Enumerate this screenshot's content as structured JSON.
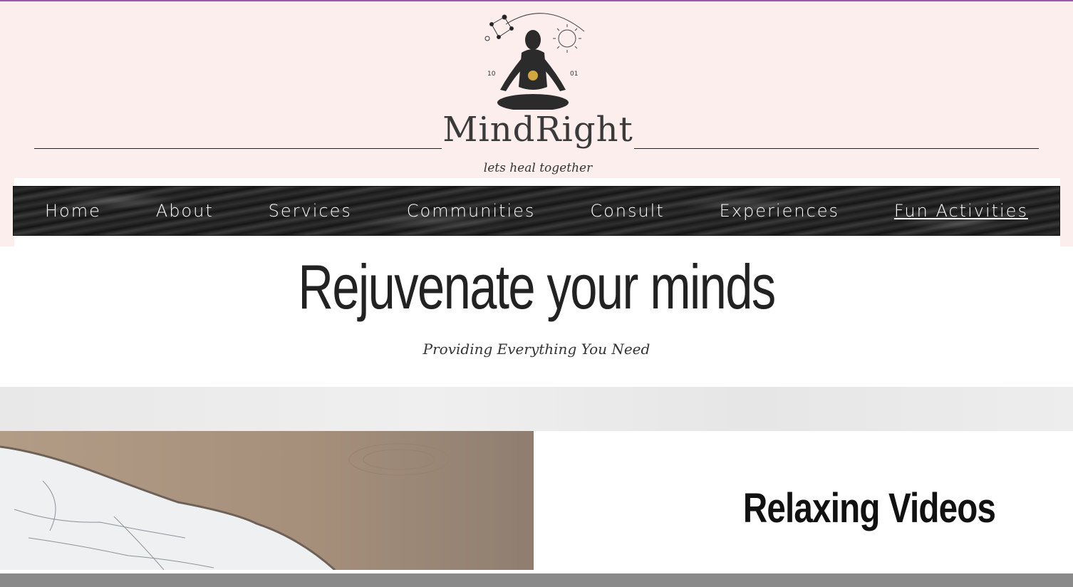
{
  "brand": {
    "name": "MindRight",
    "tagline": "lets heal together"
  },
  "nav": {
    "items": [
      {
        "label": "Home"
      },
      {
        "label": "About"
      },
      {
        "label": "Services"
      },
      {
        "label": "Communities"
      },
      {
        "label": "Consult"
      },
      {
        "label": "Experiences"
      },
      {
        "label": "Fun Activities"
      }
    ],
    "active": "Fun Activities"
  },
  "hero": {
    "title": "Rejuvenate your minds",
    "subtitle": "Providing Everything You Need"
  },
  "section": {
    "title": "Relaxing Videos"
  },
  "colors": {
    "header_bg": "#fdeeee",
    "nav_text": "#ffffff",
    "top_accent": "#9b59b6"
  },
  "icons": {
    "logo": "meditating-figure-icon"
  }
}
